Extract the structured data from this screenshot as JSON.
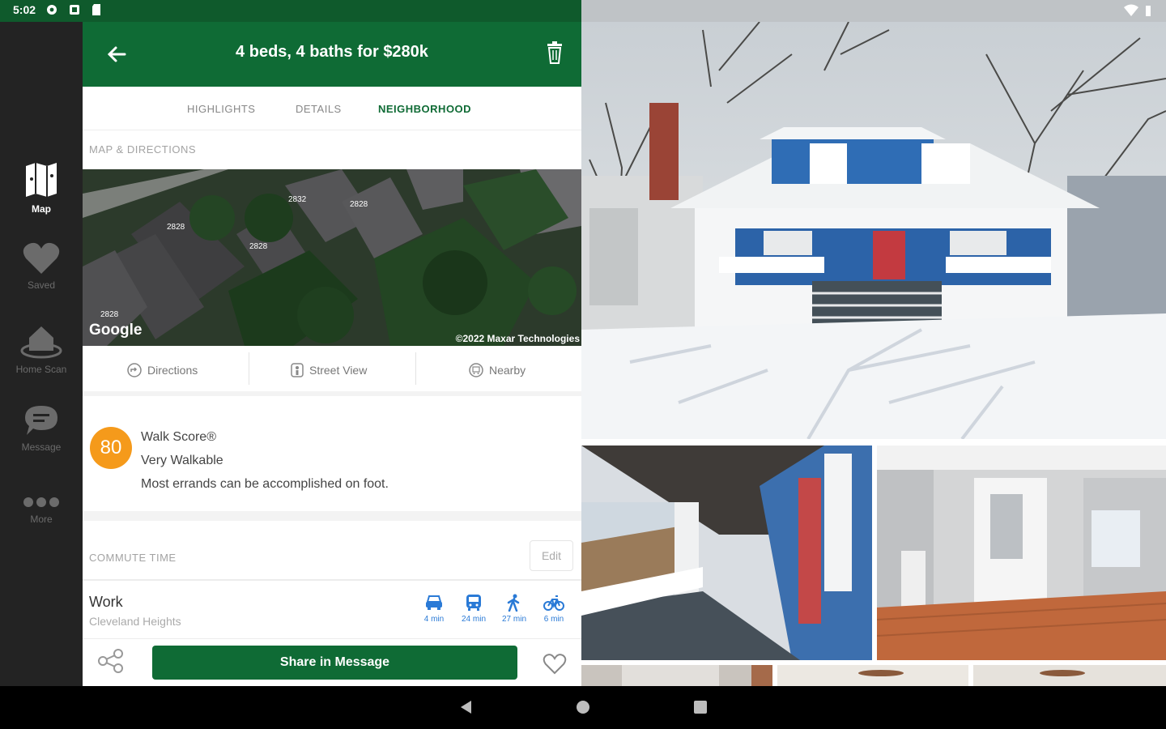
{
  "status_bar": {
    "time": "5:02"
  },
  "sidebar": {
    "items": [
      {
        "label": "Map",
        "icon": "map-icon",
        "active": true
      },
      {
        "label": "Saved",
        "icon": "heart-icon"
      },
      {
        "label": "Home Scan",
        "icon": "home-scan-icon"
      },
      {
        "label": "Message",
        "icon": "chat-icon"
      },
      {
        "label": "More",
        "icon": "more-icon"
      }
    ]
  },
  "header": {
    "title": "4 beds, 4 baths for $280k"
  },
  "tabs": [
    "HIGHLIGHTS",
    "DETAILS",
    "NEIGHBORHOOD"
  ],
  "map": {
    "section_label": "MAP & DIRECTIONS",
    "brand": "Google",
    "copyright": "©2022 Maxar Technologies",
    "house_numbers": [
      "2832",
      "2828",
      "2828",
      "2828",
      "2828"
    ]
  },
  "map_actions": [
    "Directions",
    "Street View",
    "Nearby"
  ],
  "walk_score": {
    "score": "80",
    "title": "Walk Score®",
    "rating": "Very Walkable",
    "description": "Most errands can be accomplished on foot."
  },
  "commute": {
    "section_label": "COMMUTE TIME",
    "edit_label": "Edit",
    "place": "Work",
    "place_sub": "Cleveland Heights",
    "modes": [
      {
        "icon": "car-icon",
        "time": "4 min"
      },
      {
        "icon": "bus-icon",
        "time": "24 min"
      },
      {
        "icon": "walk-icon",
        "time": "27 min"
      },
      {
        "icon": "bike-icon",
        "time": "6 min"
      }
    ]
  },
  "actions": {
    "share_label": "Share in Message"
  },
  "colors": {
    "brand_green": "#0f6b35",
    "walk_badge": "#f59a1b",
    "commute_blue": "#2a7ad6"
  }
}
